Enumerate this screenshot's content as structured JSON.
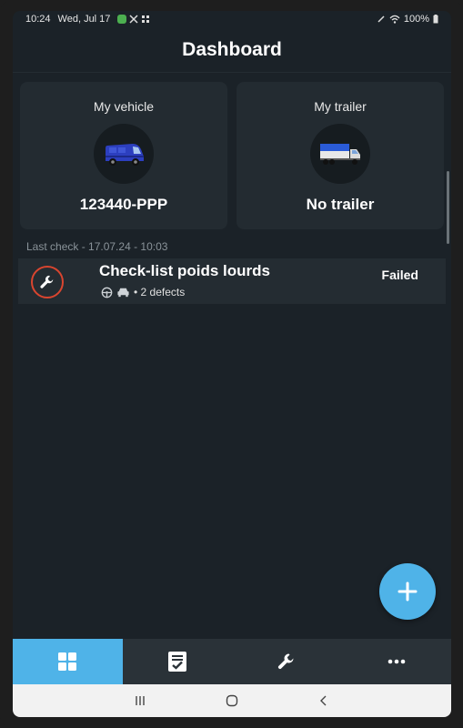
{
  "status_bar": {
    "time": "10:24",
    "date": "Wed, Jul 17",
    "battery": "100%",
    "icons": [
      "app-notification-icon",
      "tools-icon",
      "grid-icon",
      "edit-icon",
      "wifi-icon",
      "battery-icon"
    ]
  },
  "header": {
    "title": "Dashboard"
  },
  "cards": {
    "vehicle": {
      "label": "My vehicle",
      "value": "123440-PPP",
      "icon": "van-icon"
    },
    "trailer": {
      "label": "My trailer",
      "value": "No trailer",
      "icon": "truck-icon"
    }
  },
  "last_check": {
    "label": "Last check - 17.07.24 - 10:03",
    "title": "Check-list poids lourds",
    "defects": "• 2 defects",
    "status": "Failed",
    "status_color": "#d9452f"
  },
  "bottom_nav": {
    "tabs": [
      {
        "icon": "dashboard-icon",
        "active": true
      },
      {
        "icon": "checklist-icon",
        "active": false
      },
      {
        "icon": "wrench-icon",
        "active": false
      },
      {
        "icon": "more-icon",
        "active": false
      }
    ]
  },
  "colors": {
    "accent": "#4fb3e8",
    "background": "#1b2228",
    "card": "#232b31",
    "failed_ring": "#d9452f"
  }
}
